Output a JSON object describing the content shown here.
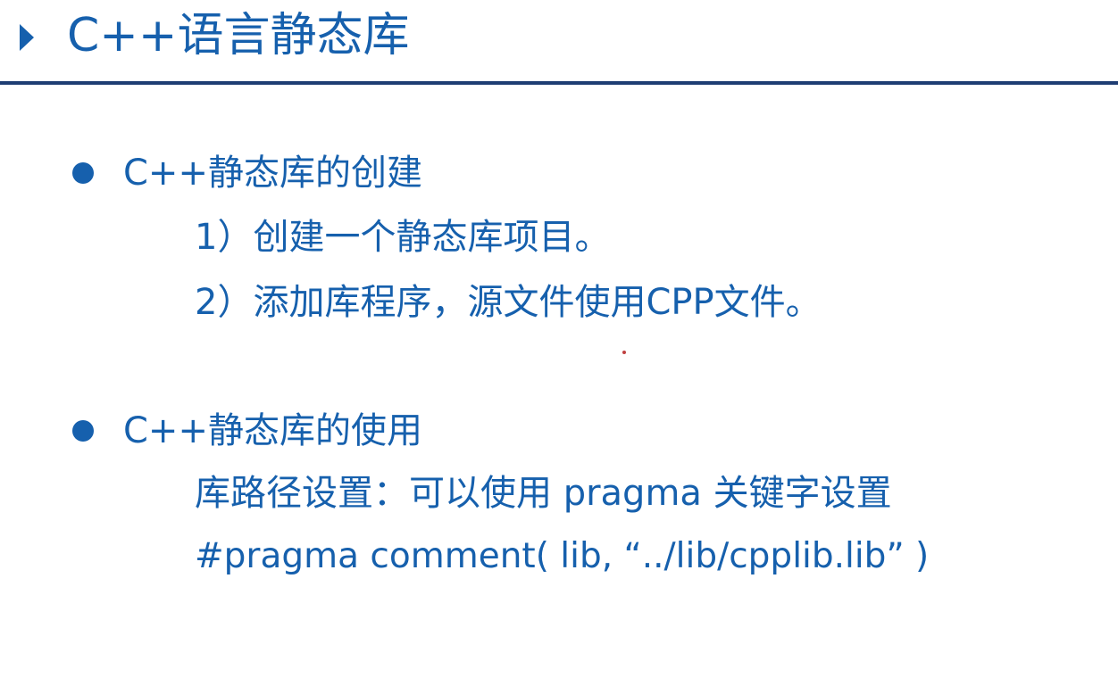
{
  "slide": {
    "title": "C++语言静态库",
    "sections": [
      {
        "heading": "C++静态库的创建",
        "lines": [
          "1）创建一个静态库项目。",
          "2）添加库程序，源文件使用CPP文件。"
        ]
      },
      {
        "heading": "C++静态库的使用",
        "lines": [
          "库路径设置：可以使用 pragma 关键字设置",
          "#pragma comment( lib, “../lib/cpplib.lib” )"
        ]
      }
    ]
  },
  "colors": {
    "text": "#1660ad",
    "rule": "#1e3d73",
    "background": "#ffffff"
  },
  "icons": {
    "title_marker": "triangle-right-icon",
    "bullet": "bullet-dot-icon"
  }
}
